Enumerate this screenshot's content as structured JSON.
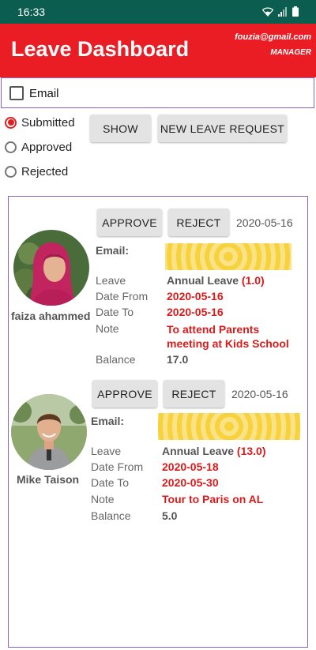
{
  "status_bar": {
    "time": "16:33"
  },
  "app_bar": {
    "title": "Leave Dashboard",
    "user_email": "fouzia@gmail.com",
    "role": "MANAGER"
  },
  "filter": {
    "email_checkbox_label": "Email",
    "radio_options": [
      "Submitted",
      "Approved",
      "Rejected"
    ],
    "selected": "Submitted",
    "show_button": "SHOW",
    "new_request_button": "NEW LEAVE REQUEST"
  },
  "requests": [
    {
      "approve": "APPROVE",
      "reject": "REJECT",
      "date": "2020-05-16",
      "name": "faiza ahammed",
      "email_label": "Email:",
      "leave_label": "Leave",
      "leave_type": "Annual Leave",
      "leave_days": "(1.0)",
      "date_from_label": "Date From",
      "date_from": "2020-05-16",
      "date_to_label": "Date To",
      "date_to": "2020-05-16",
      "note_label": "Note",
      "note": "To attend Parents meeting at Kids School",
      "balance_label": "Balance",
      "balance": "17.0"
    },
    {
      "approve": "APPROVE",
      "reject": "REJECT",
      "date": "2020-05-16",
      "name": "Mike Taison",
      "email_label": "Email:",
      "leave_label": "Leave",
      "leave_type": "Annual Leave",
      "leave_days": "(13.0)",
      "date_from_label": "Date From",
      "date_from": "2020-05-18",
      "date_to_label": "Date To",
      "date_to": "2020-05-30",
      "note_label": "Note",
      "note": "Tour to Paris on AL",
      "balance_label": "Balance",
      "balance": "5.0"
    }
  ],
  "colors": {
    "status_bar": "#0b5e4f",
    "app_bar": "#ea1c24",
    "accent_red": "#d81b1b",
    "panel_border": "#8d5fc2"
  },
  "icons": [
    "wifi-icon",
    "signal-icon",
    "battery-icon",
    "avatar-woman",
    "avatar-man"
  ]
}
